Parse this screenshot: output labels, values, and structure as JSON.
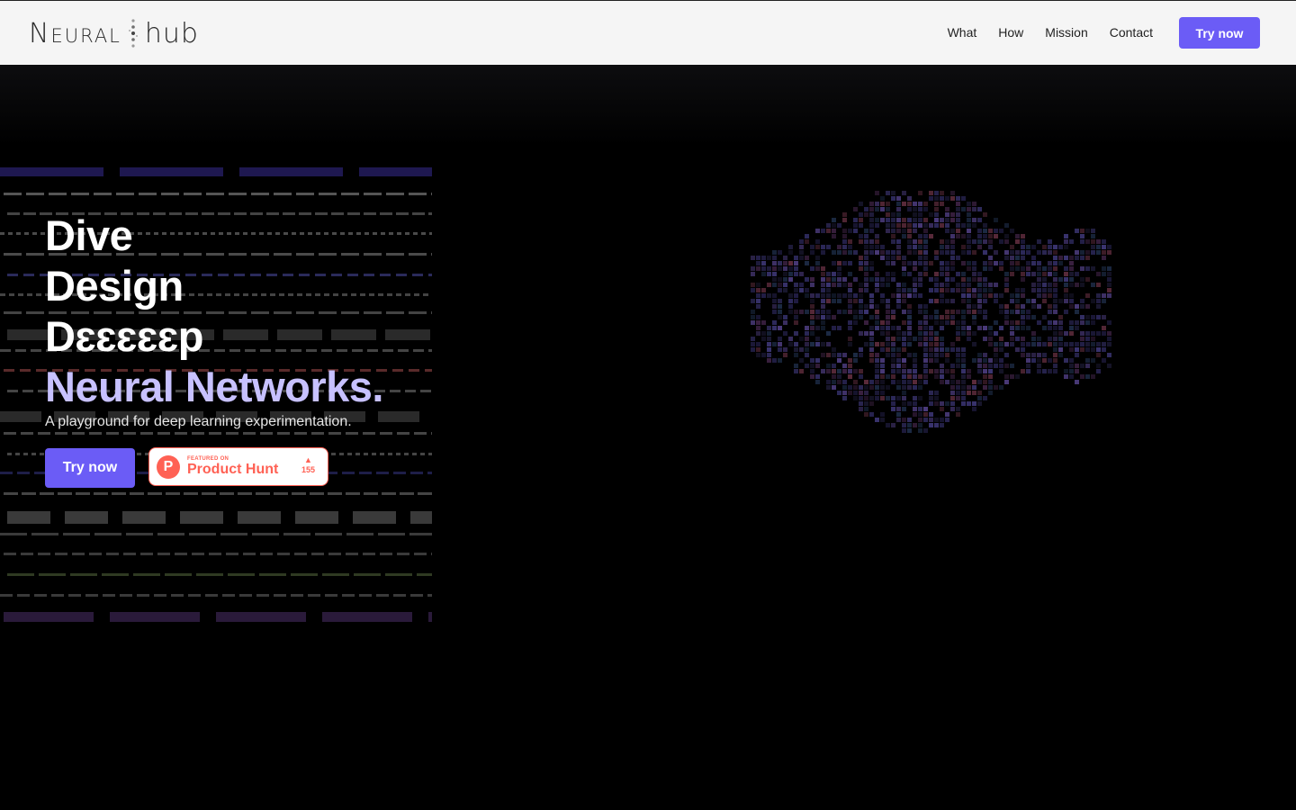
{
  "header": {
    "logo_left": "Neural",
    "logo_right": "hub",
    "nav": [
      "What",
      "How",
      "Mission",
      "Contact"
    ],
    "cta_label": "Try now"
  },
  "hero": {
    "headline": {
      "line1": "Dive",
      "line2": "Design",
      "line3": "Dɛɛɛɛɛp",
      "line4": "Neural Networks."
    },
    "tagline": "A playground for deep learning experimentation.",
    "cta_label": "Try now",
    "product_hunt": {
      "featured_label": "FEATURED ON",
      "name": "Product Hunt",
      "votes": "155",
      "icon": "product-hunt-logo"
    }
  },
  "colors": {
    "accent": "#6b5cf6",
    "headline_accent": "#c7c1ff",
    "product_hunt": "#ff6154",
    "header_bg": "#f5f5f5",
    "hero_bg": "#000000"
  }
}
